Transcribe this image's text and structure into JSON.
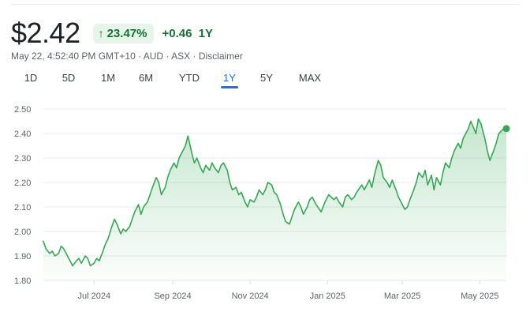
{
  "quote": {
    "price": "$2.42",
    "percent_change": "23.47%",
    "abs_change": "+0.46",
    "period": "1Y",
    "timestamp": "May 22, 4:52:40 PM GMT+10",
    "currency": "AUD",
    "exchange": "ASX",
    "disclaimer": "Disclaimer"
  },
  "colors": {
    "positive": "#137333",
    "line": "#34a853",
    "accent": "#1a73e8"
  },
  "range_tabs": [
    {
      "label": "1D",
      "active": false
    },
    {
      "label": "5D",
      "active": false
    },
    {
      "label": "1M",
      "active": false
    },
    {
      "label": "6M",
      "active": false
    },
    {
      "label": "YTD",
      "active": false
    },
    {
      "label": "1Y",
      "active": true
    },
    {
      "label": "5Y",
      "active": false
    },
    {
      "label": "MAX",
      "active": false
    }
  ],
  "chart_data": {
    "type": "area",
    "title": "",
    "xlabel": "",
    "ylabel": "",
    "ylim": [
      1.8,
      2.5
    ],
    "yticks": [
      "2.50",
      "2.40",
      "2.30",
      "2.20",
      "2.10",
      "2.00",
      "1.90",
      "1.80"
    ],
    "xlim": [
      "2024-05-22",
      "2025-05-22"
    ],
    "xticks": [
      {
        "label": "Jul 2024",
        "date": "2024-07-01"
      },
      {
        "label": "Sep 2024",
        "date": "2024-09-01"
      },
      {
        "label": "Nov 2024",
        "date": "2024-11-01"
      },
      {
        "label": "Jan 2025",
        "date": "2025-01-01"
      },
      {
        "label": "Mar 2025",
        "date": "2025-03-01"
      },
      {
        "label": "May 2025",
        "date": "2025-05-01"
      }
    ],
    "grid": "horizontal",
    "series": [
      {
        "points": [
          [
            "2024-05-22",
            1.96
          ],
          [
            "2024-05-24",
            1.93
          ],
          [
            "2024-05-27",
            1.91
          ],
          [
            "2024-05-29",
            1.92
          ],
          [
            "2024-05-31",
            1.9
          ],
          [
            "2024-06-03",
            1.91
          ],
          [
            "2024-06-05",
            1.94
          ],
          [
            "2024-06-07",
            1.93
          ],
          [
            "2024-06-10",
            1.9
          ],
          [
            "2024-06-12",
            1.88
          ],
          [
            "2024-06-14",
            1.86
          ],
          [
            "2024-06-17",
            1.88
          ],
          [
            "2024-06-19",
            1.89
          ],
          [
            "2024-06-21",
            1.87
          ],
          [
            "2024-06-24",
            1.9
          ],
          [
            "2024-06-26",
            1.89
          ],
          [
            "2024-06-28",
            1.86
          ],
          [
            "2024-07-01",
            1.87
          ],
          [
            "2024-07-03",
            1.89
          ],
          [
            "2024-07-05",
            1.88
          ],
          [
            "2024-07-08",
            1.92
          ],
          [
            "2024-07-10",
            1.95
          ],
          [
            "2024-07-12",
            1.97
          ],
          [
            "2024-07-15",
            2.02
          ],
          [
            "2024-07-17",
            2.05
          ],
          [
            "2024-07-19",
            2.03
          ],
          [
            "2024-07-22",
            1.99
          ],
          [
            "2024-07-24",
            2.01
          ],
          [
            "2024-07-26",
            2.0
          ],
          [
            "2024-07-29",
            2.02
          ],
          [
            "2024-07-31",
            2.05
          ],
          [
            "2024-08-02",
            2.08
          ],
          [
            "2024-08-05",
            2.11
          ],
          [
            "2024-08-07",
            2.07
          ],
          [
            "2024-08-09",
            2.1
          ],
          [
            "2024-08-12",
            2.12
          ],
          [
            "2024-08-14",
            2.15
          ],
          [
            "2024-08-16",
            2.18
          ],
          [
            "2024-08-19",
            2.22
          ],
          [
            "2024-08-21",
            2.2
          ],
          [
            "2024-08-23",
            2.15
          ],
          [
            "2024-08-26",
            2.18
          ],
          [
            "2024-08-28",
            2.22
          ],
          [
            "2024-08-30",
            2.25
          ],
          [
            "2024-09-02",
            2.28
          ],
          [
            "2024-09-04",
            2.26
          ],
          [
            "2024-09-06",
            2.3
          ],
          [
            "2024-09-09",
            2.33
          ],
          [
            "2024-09-11",
            2.35
          ],
          [
            "2024-09-13",
            2.39
          ],
          [
            "2024-09-16",
            2.32
          ],
          [
            "2024-09-18",
            2.28
          ],
          [
            "2024-09-20",
            2.3
          ],
          [
            "2024-09-23",
            2.26
          ],
          [
            "2024-09-25",
            2.24
          ],
          [
            "2024-09-27",
            2.27
          ],
          [
            "2024-09-30",
            2.25
          ],
          [
            "2024-10-02",
            2.28
          ],
          [
            "2024-10-04",
            2.26
          ],
          [
            "2024-10-07",
            2.24
          ],
          [
            "2024-10-09",
            2.27
          ],
          [
            "2024-10-11",
            2.28
          ],
          [
            "2024-10-14",
            2.25
          ],
          [
            "2024-10-16",
            2.2
          ],
          [
            "2024-10-18",
            2.17
          ],
          [
            "2024-10-21",
            2.18
          ],
          [
            "2024-10-23",
            2.15
          ],
          [
            "2024-10-25",
            2.16
          ],
          [
            "2024-10-28",
            2.12
          ],
          [
            "2024-10-30",
            2.1
          ],
          [
            "2024-11-01",
            2.13
          ],
          [
            "2024-11-04",
            2.12
          ],
          [
            "2024-11-06",
            2.14
          ],
          [
            "2024-11-08",
            2.17
          ],
          [
            "2024-11-11",
            2.15
          ],
          [
            "2024-11-13",
            2.17
          ],
          [
            "2024-11-15",
            2.2
          ],
          [
            "2024-11-18",
            2.19
          ],
          [
            "2024-11-20",
            2.16
          ],
          [
            "2024-11-22",
            2.15
          ],
          [
            "2024-11-25",
            2.11
          ],
          [
            "2024-11-27",
            2.07
          ],
          [
            "2024-11-29",
            2.04
          ],
          [
            "2024-12-02",
            2.03
          ],
          [
            "2024-12-04",
            2.06
          ],
          [
            "2024-12-06",
            2.09
          ],
          [
            "2024-12-09",
            2.12
          ],
          [
            "2024-12-11",
            2.1
          ],
          [
            "2024-12-13",
            2.07
          ],
          [
            "2024-12-16",
            2.1
          ],
          [
            "2024-12-18",
            2.13
          ],
          [
            "2024-12-20",
            2.14
          ],
          [
            "2024-12-23",
            2.11
          ],
          [
            "2024-12-27",
            2.08
          ],
          [
            "2024-12-30",
            2.12
          ],
          [
            "2025-01-02",
            2.15
          ],
          [
            "2025-01-06",
            2.13
          ],
          [
            "2025-01-08",
            2.14
          ],
          [
            "2025-01-10",
            2.12
          ],
          [
            "2025-01-13",
            2.1
          ],
          [
            "2025-01-15",
            2.14
          ],
          [
            "2025-01-17",
            2.15
          ],
          [
            "2025-01-20",
            2.13
          ],
          [
            "2025-01-22",
            2.14
          ],
          [
            "2025-01-24",
            2.16
          ],
          [
            "2025-01-28",
            2.19
          ],
          [
            "2025-01-30",
            2.17
          ],
          [
            "2025-02-03",
            2.21
          ],
          [
            "2025-02-05",
            2.18
          ],
          [
            "2025-02-07",
            2.23
          ],
          [
            "2025-02-10",
            2.29
          ],
          [
            "2025-02-12",
            2.27
          ],
          [
            "2025-02-14",
            2.22
          ],
          [
            "2025-02-17",
            2.2
          ],
          [
            "2025-02-19",
            2.18
          ],
          [
            "2025-02-21",
            2.21
          ],
          [
            "2025-02-24",
            2.17
          ],
          [
            "2025-02-26",
            2.14
          ],
          [
            "2025-02-28",
            2.12
          ],
          [
            "2025-03-03",
            2.09
          ],
          [
            "2025-03-05",
            2.1
          ],
          [
            "2025-03-07",
            2.13
          ],
          [
            "2025-03-10",
            2.17
          ],
          [
            "2025-03-12",
            2.2
          ],
          [
            "2025-03-14",
            2.24
          ],
          [
            "2025-03-17",
            2.22
          ],
          [
            "2025-03-19",
            2.25
          ],
          [
            "2025-03-21",
            2.19
          ],
          [
            "2025-03-24",
            2.23
          ],
          [
            "2025-03-26",
            2.17
          ],
          [
            "2025-03-28",
            2.22
          ],
          [
            "2025-03-31",
            2.19
          ],
          [
            "2025-04-02",
            2.24
          ],
          [
            "2025-04-04",
            2.28
          ],
          [
            "2025-04-07",
            2.26
          ],
          [
            "2025-04-09",
            2.3
          ],
          [
            "2025-04-11",
            2.33
          ],
          [
            "2025-04-14",
            2.36
          ],
          [
            "2025-04-16",
            2.34
          ],
          [
            "2025-04-18",
            2.38
          ],
          [
            "2025-04-22",
            2.42
          ],
          [
            "2025-04-24",
            2.45
          ],
          [
            "2025-04-28",
            2.4
          ],
          [
            "2025-04-30",
            2.46
          ],
          [
            "2025-05-02",
            2.44
          ],
          [
            "2025-05-05",
            2.38
          ],
          [
            "2025-05-07",
            2.33
          ],
          [
            "2025-05-09",
            2.29
          ],
          [
            "2025-05-12",
            2.33
          ],
          [
            "2025-05-14",
            2.36
          ],
          [
            "2025-05-16",
            2.4
          ],
          [
            "2025-05-20",
            2.42
          ],
          [
            "2025-05-22",
            2.42
          ]
        ]
      }
    ]
  }
}
